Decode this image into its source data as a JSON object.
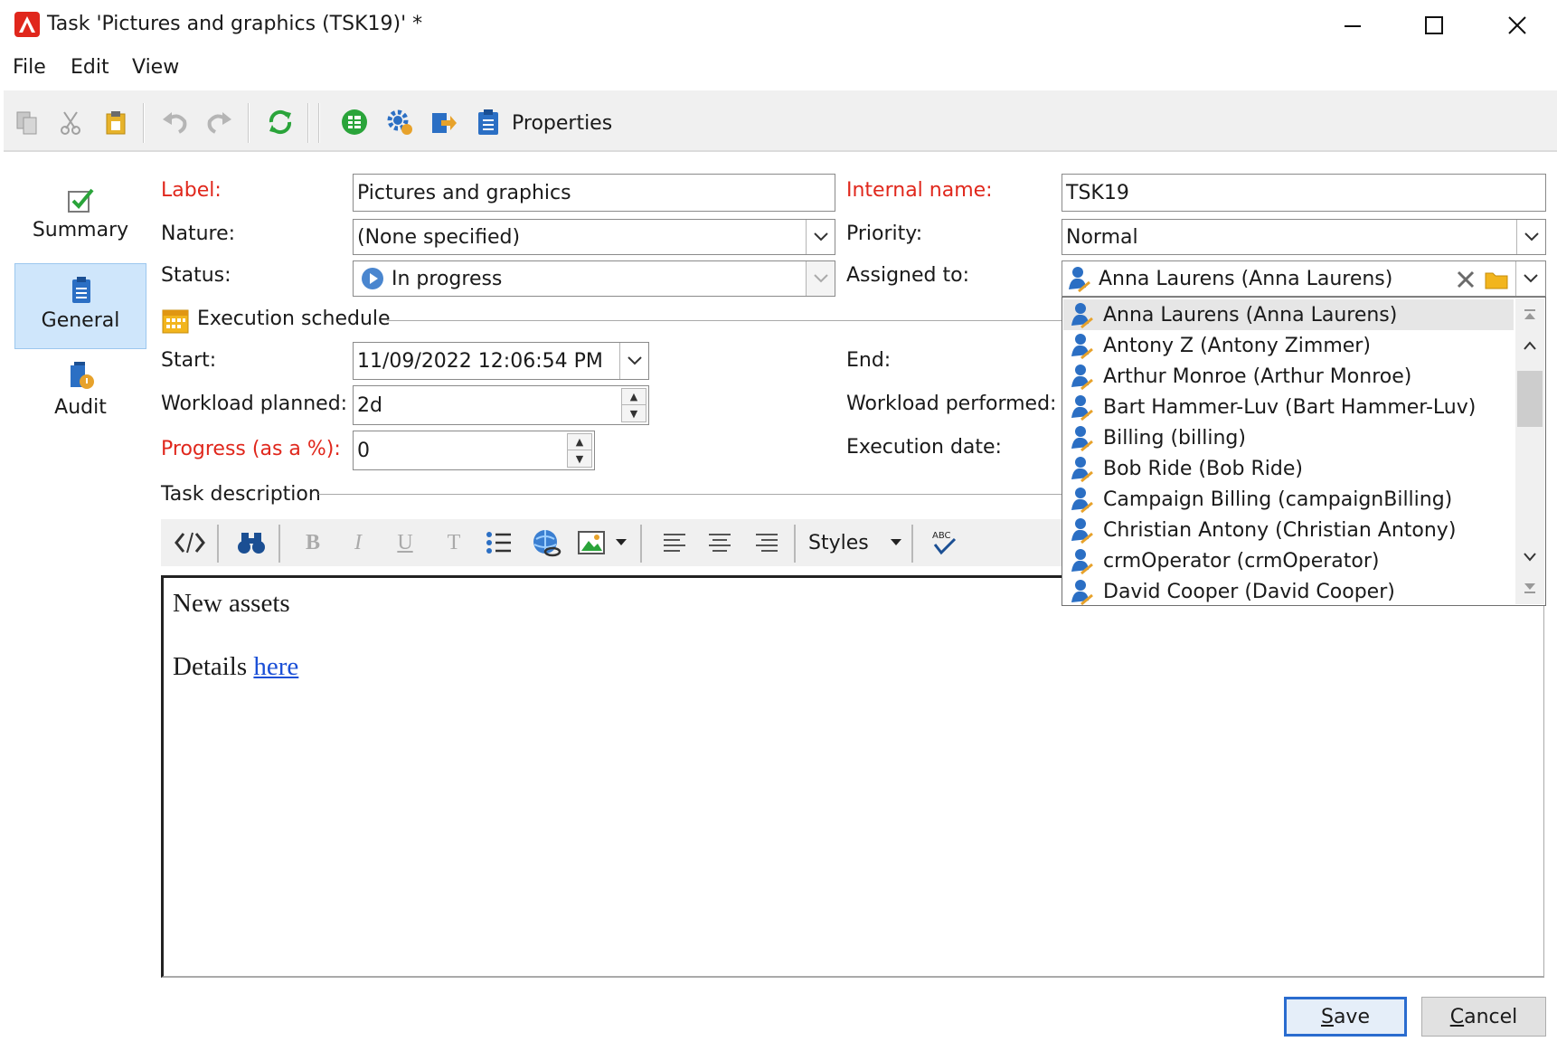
{
  "window": {
    "title": "Task 'Pictures and graphics (TSK19)' *",
    "logo_color": "#e0271c"
  },
  "menu": {
    "file": "File",
    "edit": "Edit",
    "view": "View"
  },
  "toolbar": {
    "properties_label": "Properties",
    "icons": [
      "copy-icon",
      "cut-icon",
      "paste-icon",
      "undo-icon",
      "redo-icon",
      "refresh-icon",
      "spreadsheet-icon",
      "settings-icon",
      "export-icon",
      "properties-icon"
    ]
  },
  "nav": {
    "summary": "Summary",
    "general": "General",
    "audit": "Audit",
    "active": "General"
  },
  "form": {
    "label": {
      "caption": "Label:",
      "value": "Pictures and graphics"
    },
    "internal_name": {
      "caption": "Internal name:",
      "value": "TSK19"
    },
    "nature": {
      "caption": "Nature:",
      "value": "(None specified)"
    },
    "priority": {
      "caption": "Priority:",
      "value": "Normal"
    },
    "status": {
      "caption": "Status:",
      "value": "In progress"
    },
    "assigned_to": {
      "caption": "Assigned to:",
      "value": "Anna Laurens (Anna Laurens)"
    },
    "execution_schedule": "Execution schedule",
    "start": {
      "caption": "Start:",
      "value": "11/09/2022 12:06:54 PM"
    },
    "end": {
      "caption": "End:"
    },
    "workload_planned": {
      "caption": "Workload planned:",
      "value": "2d"
    },
    "workload_performed": {
      "caption": "Workload performed:"
    },
    "progress": {
      "caption": "Progress (as a %):",
      "value": "0"
    },
    "execution_date": {
      "caption": "Execution date:"
    },
    "task_description": "Task description"
  },
  "editor": {
    "styles_label": "Styles",
    "line1": "New assets",
    "line2_prefix": "Details ",
    "link_text": "here"
  },
  "assignee_options": [
    "Anna Laurens (Anna Laurens)",
    "Antony Z (Antony Zimmer)",
    "Arthur Monroe (Arthur Monroe)",
    "Bart Hammer-Luv (Bart Hammer-Luv)",
    "Billing (billing)",
    "Bob Ride (Bob Ride)",
    "Campaign Billing (campaignBilling)",
    "Christian Antony (Christian Antony)",
    "crmOperator (crmOperator)",
    "David Cooper (David Cooper)"
  ],
  "assignee_selected_index": 0,
  "buttons": {
    "save": {
      "first": "S",
      "rest": "ave"
    },
    "cancel": {
      "first": "C",
      "rest": "ancel"
    }
  },
  "colors": {
    "required_label": "#e0271c",
    "nav_active": "#cfe6fb",
    "link": "#1a4fd6",
    "save_border": "#2a6ccf"
  }
}
